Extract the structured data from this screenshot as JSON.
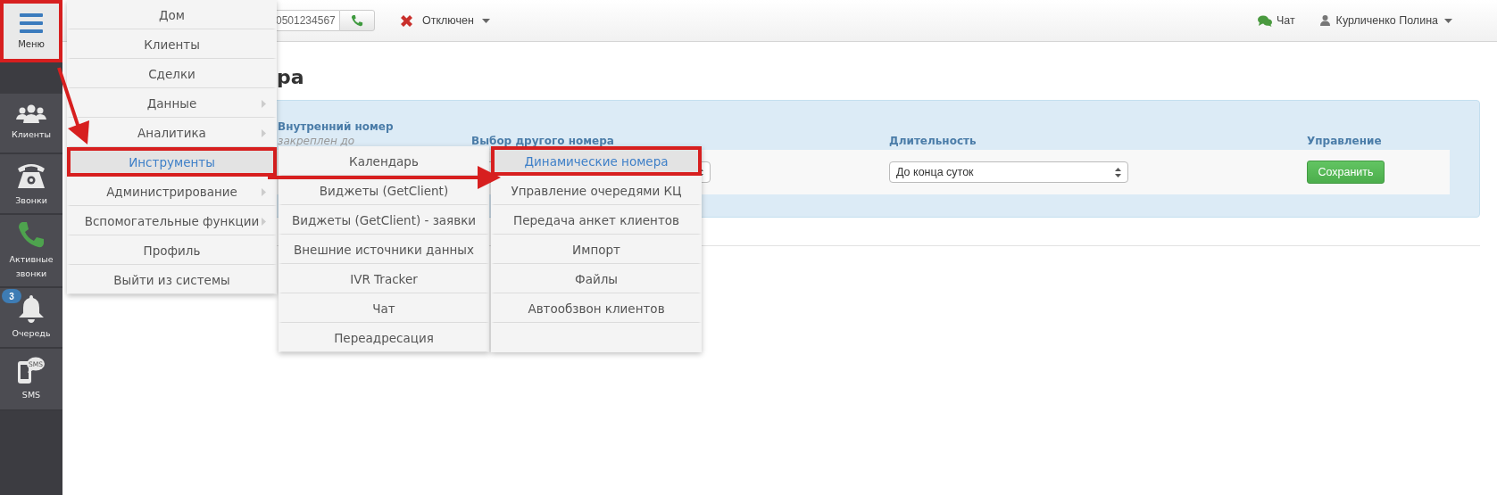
{
  "sidebar": {
    "menu_button": {
      "label": "Меню",
      "highlighted": true
    },
    "items": [
      {
        "kind": "clients",
        "label": "Клиенты"
      },
      {
        "kind": "calls",
        "label": "Звонки"
      },
      {
        "kind": "active_calls",
        "label": "Активные звонки"
      },
      {
        "kind": "queue",
        "label": "Очередь",
        "badge": "3"
      },
      {
        "kind": "sms",
        "label": "SMS",
        "icon_text": "SMS"
      }
    ]
  },
  "topbar": {
    "phone": {
      "value": "0501234567"
    },
    "status": {
      "label": "Отключен"
    },
    "chat": {
      "label": "Чат"
    },
    "user": {
      "name": "Курличенко Полина"
    }
  },
  "page": {
    "title_fragment": "ра",
    "panel": {
      "columns": [
        {
          "label": "Внутренний номер",
          "note": "закреплен до"
        },
        {
          "label": "Выбор другого номера"
        },
        {
          "label": "Длительность"
        },
        {
          "label": "Управление"
        }
      ],
      "duration": {
        "value": "До конца суток"
      },
      "save_button": {
        "label": "Сохранить"
      }
    }
  },
  "menu": {
    "items": [
      {
        "label": "Дом",
        "has_submenu": false,
        "selected": false,
        "highlighted": false
      },
      {
        "label": "Клиенты",
        "has_submenu": false,
        "selected": false,
        "highlighted": false
      },
      {
        "label": "Сделки",
        "has_submenu": false,
        "selected": false,
        "highlighted": false
      },
      {
        "label": "Данные",
        "has_submenu": true,
        "selected": false,
        "highlighted": false
      },
      {
        "label": "Аналитика",
        "has_submenu": true,
        "selected": false,
        "highlighted": false
      },
      {
        "label": "Инструменты",
        "has_submenu": false,
        "selected": true,
        "highlighted": true
      },
      {
        "label": "Администрирование",
        "has_submenu": true,
        "selected": false,
        "highlighted": false
      },
      {
        "label": "Вспомогательные функции",
        "has_submenu": true,
        "selected": false,
        "highlighted": false
      },
      {
        "label": "Профиль",
        "has_submenu": false,
        "selected": false,
        "highlighted": false
      },
      {
        "label": "Выйти из системы",
        "has_submenu": false,
        "selected": false,
        "highlighted": false
      }
    ]
  },
  "submenu": {
    "items": [
      {
        "label": "Календарь",
        "selected": false,
        "highlighted": false
      },
      {
        "label": "Виджеты (GetClient)",
        "selected": false,
        "highlighted": false
      },
      {
        "label": "Виджеты (GetClient) - заявки",
        "selected": false,
        "highlighted": false
      },
      {
        "label": "Внешние источники данных",
        "selected": false,
        "highlighted": false
      },
      {
        "label": "IVR Tracker",
        "selected": false,
        "highlighted": false
      },
      {
        "label": "Чат",
        "selected": false,
        "highlighted": false
      },
      {
        "label": "Переадресация",
        "selected": false,
        "highlighted": false
      }
    ]
  },
  "submenu_2": {
    "items": [
      {
        "label": "Динамические номера",
        "selected": true,
        "highlighted": true
      },
      {
        "label": "Управление очередями КЦ",
        "selected": false,
        "highlighted": false
      },
      {
        "label": "Передача анкет клиентов",
        "selected": false,
        "highlighted": false
      },
      {
        "label": "Импорт",
        "selected": false,
        "highlighted": false
      },
      {
        "label": "Файлы",
        "selected": false,
        "highlighted": false
      },
      {
        "label": "Автообзвон клиентов",
        "selected": false,
        "highlighted": false
      }
    ]
  }
}
